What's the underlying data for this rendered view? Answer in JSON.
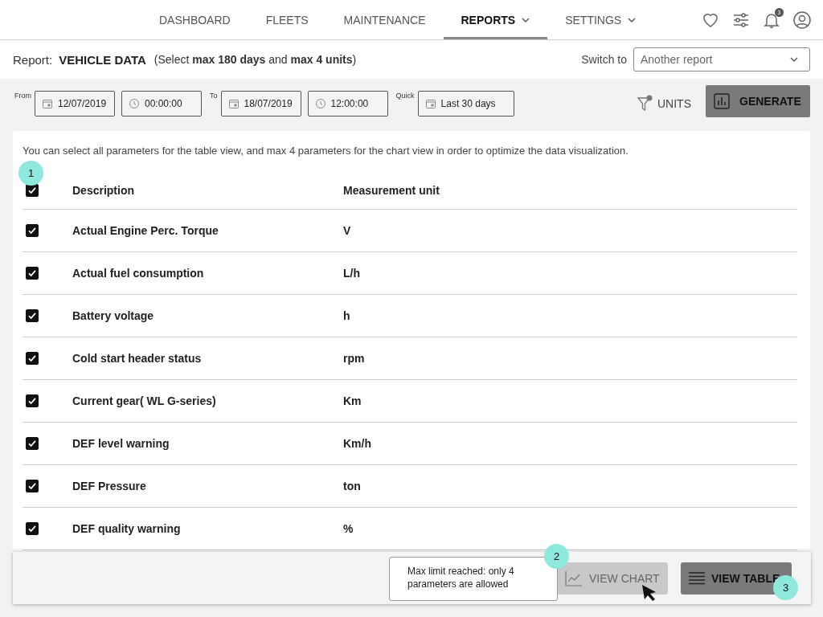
{
  "nav": {
    "items": [
      {
        "label": "DASHBOARD",
        "selected": false,
        "dropdown": false
      },
      {
        "label": "FLEETS",
        "selected": false,
        "dropdown": false
      },
      {
        "label": "MAINTENANCE",
        "selected": false,
        "dropdown": false
      },
      {
        "label": "REPORTS",
        "selected": true,
        "dropdown": true
      },
      {
        "label": "SETTINGS",
        "selected": false,
        "dropdown": true
      }
    ],
    "notification_count": "3"
  },
  "report_bar": {
    "label": "Report:",
    "name": "VEHICLE DATA",
    "hint": "(Select **max 180 days** and **max 4 units**)",
    "switch_label": "Switch to",
    "switch_placeholder": "Another report"
  },
  "filters": {
    "from_label": "From",
    "from_date": "12/07/2019",
    "from_time": "00:00:00",
    "to_label": "To",
    "to_date": "18/07/2019",
    "to_time": "12:00:00",
    "quick_label": "Quick",
    "quick_value": "Last 30 days",
    "units": "UNITS",
    "generate": "GENERATE"
  },
  "intro": "You can select all parameters for the table view, and max 4 parameters for the chart view in order to optimize the data visualization.",
  "table": {
    "columns": [
      "Description",
      "Measurement unit"
    ],
    "all_checked": true,
    "rows": [
      {
        "description": "Actual Engine Perc. Torque",
        "unit": "V",
        "checked": true
      },
      {
        "description": "Actual fuel consumption",
        "unit": "L/h",
        "checked": true
      },
      {
        "description": "Battery voltage",
        "unit": "h",
        "checked": true
      },
      {
        "description": "Cold start header status",
        "unit": "rpm",
        "checked": true
      },
      {
        "description": "Current gear( WL G-series)",
        "unit": "Km",
        "checked": true
      },
      {
        "description": "DEF level warning",
        "unit": "Km/h",
        "checked": true
      },
      {
        "description": "DEF Pressure",
        "unit": "ton",
        "checked": true
      },
      {
        "description": "DEF quality warning",
        "unit": "%",
        "checked": true
      }
    ]
  },
  "footer": {
    "tooltip": "Max limit reached: only 4 parameters are allowed",
    "view_chart": {
      "label": "VIEW CHART",
      "disabled": true
    },
    "view_table": {
      "label": "VIEW TABLE",
      "disabled": false
    }
  },
  "markers": [
    "1",
    "2",
    "3"
  ]
}
